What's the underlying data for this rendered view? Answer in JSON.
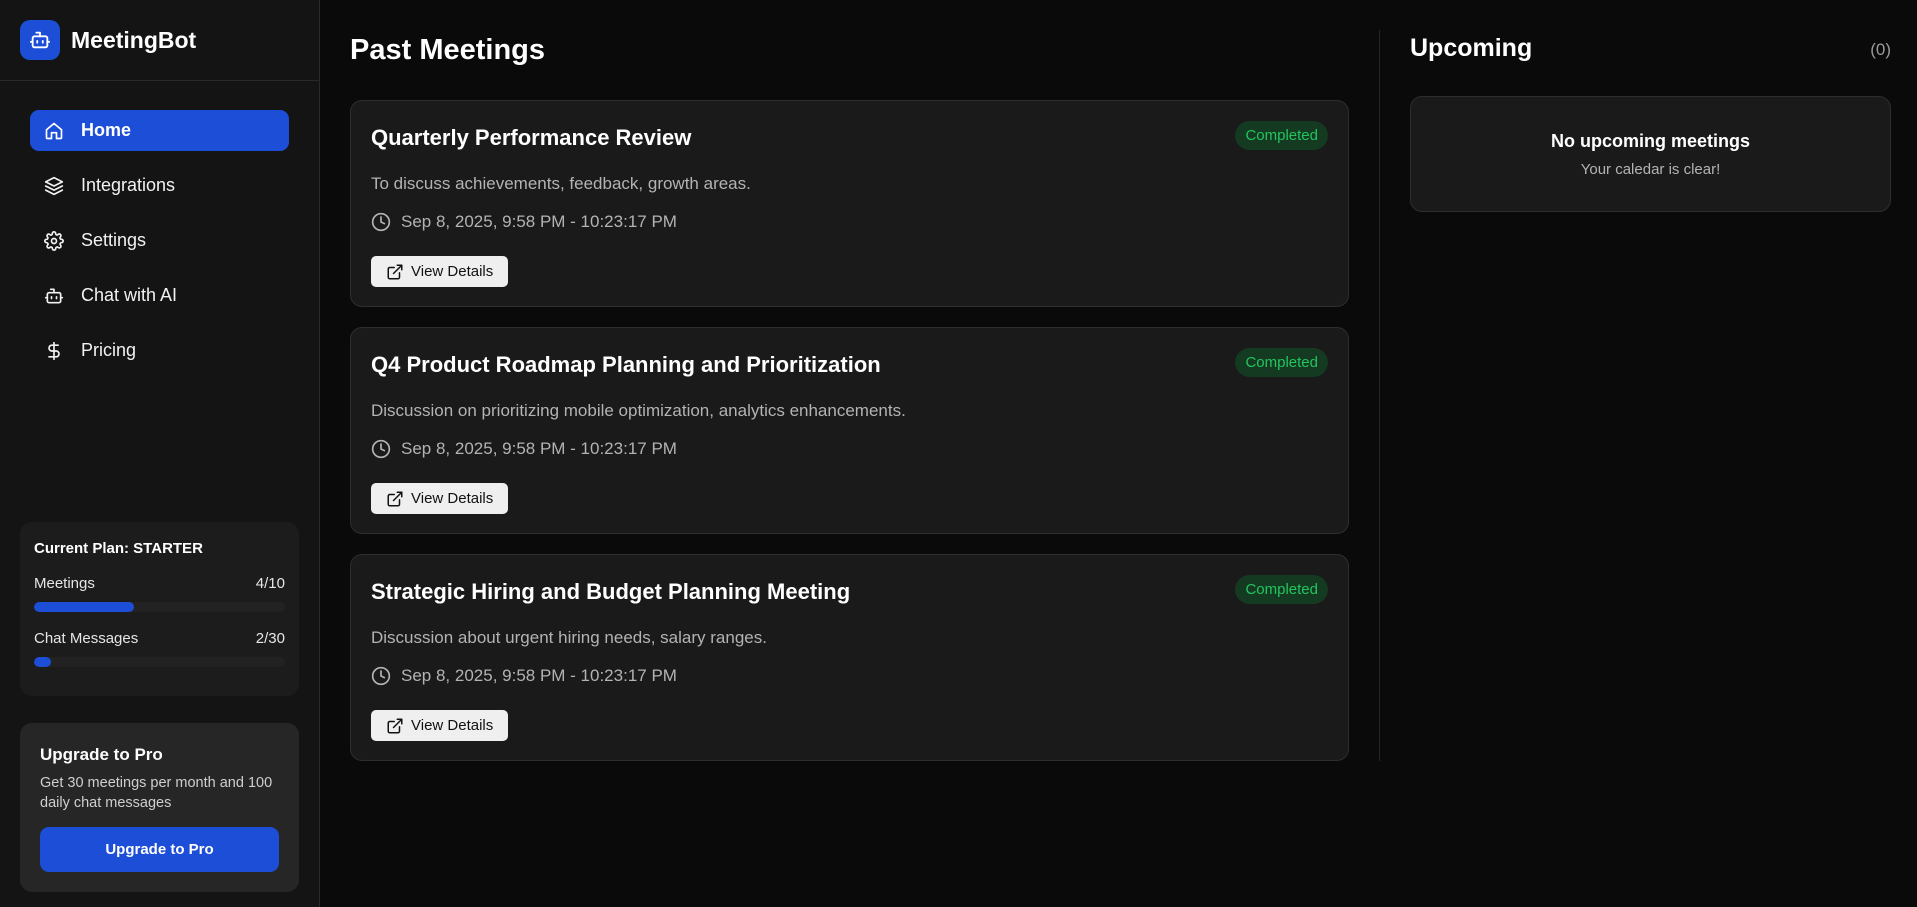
{
  "brand": {
    "name": "MeetingBot",
    "logo_icon": "robot-icon"
  },
  "sidebar": {
    "items": [
      {
        "label": "Home",
        "icon": "home-icon",
        "active": true
      },
      {
        "label": "Integrations",
        "icon": "layers-icon",
        "active": false
      },
      {
        "label": "Settings",
        "icon": "gear-icon",
        "active": false
      },
      {
        "label": "Chat with AI",
        "icon": "robot-icon",
        "active": false
      },
      {
        "label": "Pricing",
        "icon": "dollar-icon",
        "active": false
      }
    ],
    "plan": {
      "title": "Current Plan: STARTER",
      "meetings_label": "Meetings",
      "meetings_value": "4/10",
      "meetings_fraction": 0.4,
      "chat_label": "Chat Messages",
      "chat_value": "2/30",
      "chat_fraction": 0.0667
    },
    "upgrade": {
      "title": "Upgrade to Pro",
      "description": "Get 30 meetings per month and 100 daily chat messages",
      "button_label": "Upgrade to Pro"
    }
  },
  "main": {
    "title": "Past Meetings",
    "view_button_label": "View Details",
    "meetings": [
      {
        "title": "Quarterly Performance Review",
        "status": "Completed",
        "description": "To discuss achievements, feedback, growth areas.",
        "time": "Sep 8, 2025, 9:58 PM - 10:23:17 PM"
      },
      {
        "title": "Q4 Product Roadmap Planning and Prioritization",
        "status": "Completed",
        "description": "Discussion on prioritizing mobile optimization, analytics enhancements.",
        "time": "Sep 8, 2025, 9:58 PM - 10:23:17 PM"
      },
      {
        "title": "Strategic Hiring and Budget Planning Meeting",
        "status": "Completed",
        "description": "Discussion about urgent hiring needs, salary ranges.",
        "time": "Sep 8, 2025, 9:58 PM - 10:23:17 PM"
      }
    ]
  },
  "upcoming": {
    "title": "Upcoming",
    "count": "(0)",
    "empty_title": "No upcoming meetings",
    "empty_subtitle": "Your caledar is clear!"
  },
  "colors": {
    "accent": "#1d4ed8",
    "status_green": "#22c55e",
    "background": "#0a0a0a",
    "card": "#1a1a1a"
  }
}
